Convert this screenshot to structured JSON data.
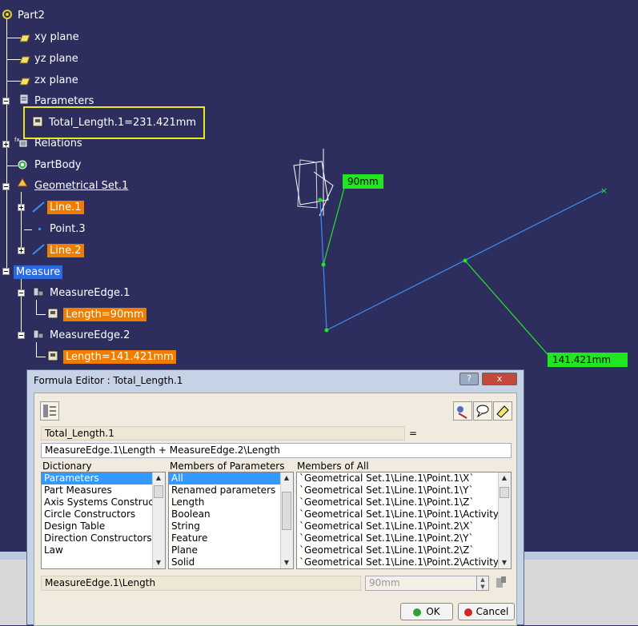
{
  "tree": {
    "root": "Part2",
    "planes": [
      "xy plane",
      "yz plane",
      "zx plane"
    ],
    "parameters": "Parameters",
    "parameter_item": "Total_Length.1=231.421mm",
    "relations": "Relations",
    "partbody": "PartBody",
    "geoset": "Geometrical Set.1",
    "line1": "Line.1",
    "point3": "Point.3",
    "line2": "Line.2",
    "measure": "Measure",
    "measure_edge1": "MeasureEdge.1",
    "length1": "Length=90mm",
    "measure_edge2": "MeasureEdge.2",
    "length2": "Length=141.421mm"
  },
  "viewport": {
    "dim1": "90mm",
    "dim2": "141.421mm"
  },
  "dialog": {
    "title": "Formula Editor : Total_Length.1",
    "help_btn": "?",
    "close_btn": "x",
    "param_name": "Total_Length.1",
    "equals": "=",
    "formula": "MeasureEdge.1\\Length + MeasureEdge.2\\Length",
    "dictionary_label": "Dictionary",
    "members_params_label": "Members of Parameters",
    "members_all_label": "Members of All",
    "dictionary_items": [
      "Parameters",
      "Part Measures",
      "Axis Systems Constructors",
      "Circle Constructors",
      "Design Table",
      "Direction Constructors",
      "Law"
    ],
    "members_params_items": [
      "All",
      "Renamed parameters",
      "Length",
      "Boolean",
      "String",
      "Feature",
      "Plane",
      "Solid"
    ],
    "members_all_items": [
      "`Geometrical Set.1\\Line.1\\Point.1\\X`",
      "`Geometrical Set.1\\Line.1\\Point.1\\Y`",
      "`Geometrical Set.1\\Line.1\\Point.1\\Z`",
      "`Geometrical Set.1\\Line.1\\Point.1\\Activity`",
      "`Geometrical Set.1\\Line.1\\Point.2\\X`",
      "`Geometrical Set.1\\Line.1\\Point.2\\Y`",
      "`Geometrical Set.1\\Line.1\\Point.2\\Z`",
      "`Geometrical Set.1\\Line.1\\Point.2\\Activity`"
    ],
    "selected_member": "MeasureEdge.1\\Length",
    "value": "90mm",
    "ok": "OK",
    "cancel": "Cancel"
  }
}
